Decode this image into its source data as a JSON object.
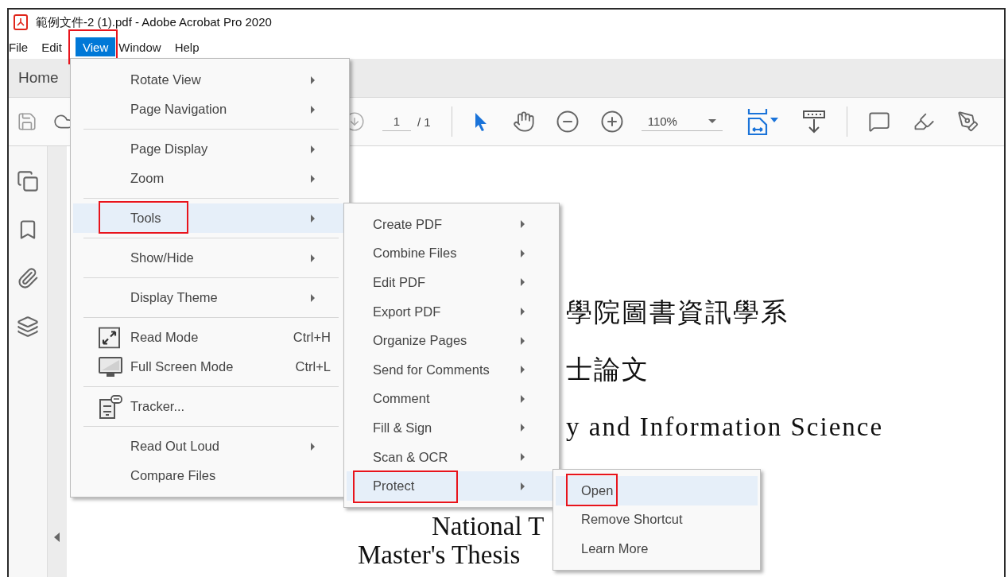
{
  "window": {
    "title": "範例文件-2 (1).pdf - Adobe Acrobat Pro 2020"
  },
  "menu_bar": [
    {
      "label": "File",
      "selected": false,
      "highlighted": false
    },
    {
      "label": "Edit",
      "selected": false,
      "highlighted": false
    },
    {
      "label": "View",
      "selected": true,
      "highlighted": true
    },
    {
      "label": "Window",
      "selected": false,
      "highlighted": false
    },
    {
      "label": "Help",
      "selected": false,
      "highlighted": false
    }
  ],
  "tabs": [
    {
      "label": "Home",
      "selected": false
    }
  ],
  "toolbar": {
    "page_number": "1",
    "page_total": "/ 1",
    "zoom": "110%"
  },
  "document": {
    "lines": [
      "學院圖書資訊學系",
      "士論文",
      "y and Information Science",
      "National T",
      "Master's Thesis"
    ]
  },
  "view_menu": {
    "groups": [
      [
        {
          "label": "Rotate View",
          "kind": "submenu",
          "selected": false,
          "highlighted": false
        },
        {
          "label": "Page Navigation",
          "kind": "submenu",
          "selected": false,
          "highlighted": false
        }
      ],
      [
        {
          "label": "Page Display",
          "kind": "submenu",
          "selected": false,
          "highlighted": false
        },
        {
          "label": "Zoom",
          "kind": "submenu",
          "selected": false,
          "highlighted": false
        }
      ],
      [
        {
          "label": "Tools",
          "kind": "submenu",
          "selected": true,
          "highlighted": true
        }
      ],
      [
        {
          "label": "Show/Hide",
          "kind": "submenu",
          "selected": false,
          "highlighted": false
        }
      ],
      [
        {
          "label": "Display Theme",
          "kind": "submenu",
          "selected": false,
          "highlighted": false
        }
      ],
      [
        {
          "label": "Read Mode",
          "kind": "command",
          "shortcut": "Ctrl+H",
          "selected": false,
          "highlighted": false
        },
        {
          "label": "Full Screen Mode",
          "kind": "command",
          "shortcut": "Ctrl+L",
          "selected": false,
          "highlighted": false
        }
      ],
      [
        {
          "label": "Tracker...",
          "kind": "command",
          "selected": false,
          "highlighted": false
        }
      ],
      [
        {
          "label": "Read Out Loud",
          "kind": "submenu",
          "selected": false,
          "highlighted": false
        },
        {
          "label": "Compare Files",
          "kind": "command",
          "selected": false,
          "highlighted": false
        }
      ]
    ]
  },
  "tools_menu": {
    "items": [
      {
        "label": "Create PDF",
        "selected": false,
        "highlighted": false
      },
      {
        "label": "Combine Files",
        "selected": false,
        "highlighted": false
      },
      {
        "label": "Edit PDF",
        "selected": false,
        "highlighted": false
      },
      {
        "label": "Export PDF",
        "selected": false,
        "highlighted": false
      },
      {
        "label": "Organize Pages",
        "selected": false,
        "highlighted": false
      },
      {
        "label": "Send for Comments",
        "selected": false,
        "highlighted": false
      },
      {
        "label": "Comment",
        "selected": false,
        "highlighted": false
      },
      {
        "label": "Fill & Sign",
        "selected": false,
        "highlighted": false
      },
      {
        "label": "Scan & OCR",
        "selected": false,
        "highlighted": false
      },
      {
        "label": "Protect",
        "selected": true,
        "highlighted": true
      }
    ]
  },
  "protect_menu": {
    "items": [
      {
        "label": "Open",
        "selected": true,
        "highlighted": true
      },
      {
        "label": "Remove Shortcut",
        "selected": false,
        "highlighted": false
      },
      {
        "label": "Learn More",
        "selected": false,
        "highlighted": false
      }
    ]
  }
}
